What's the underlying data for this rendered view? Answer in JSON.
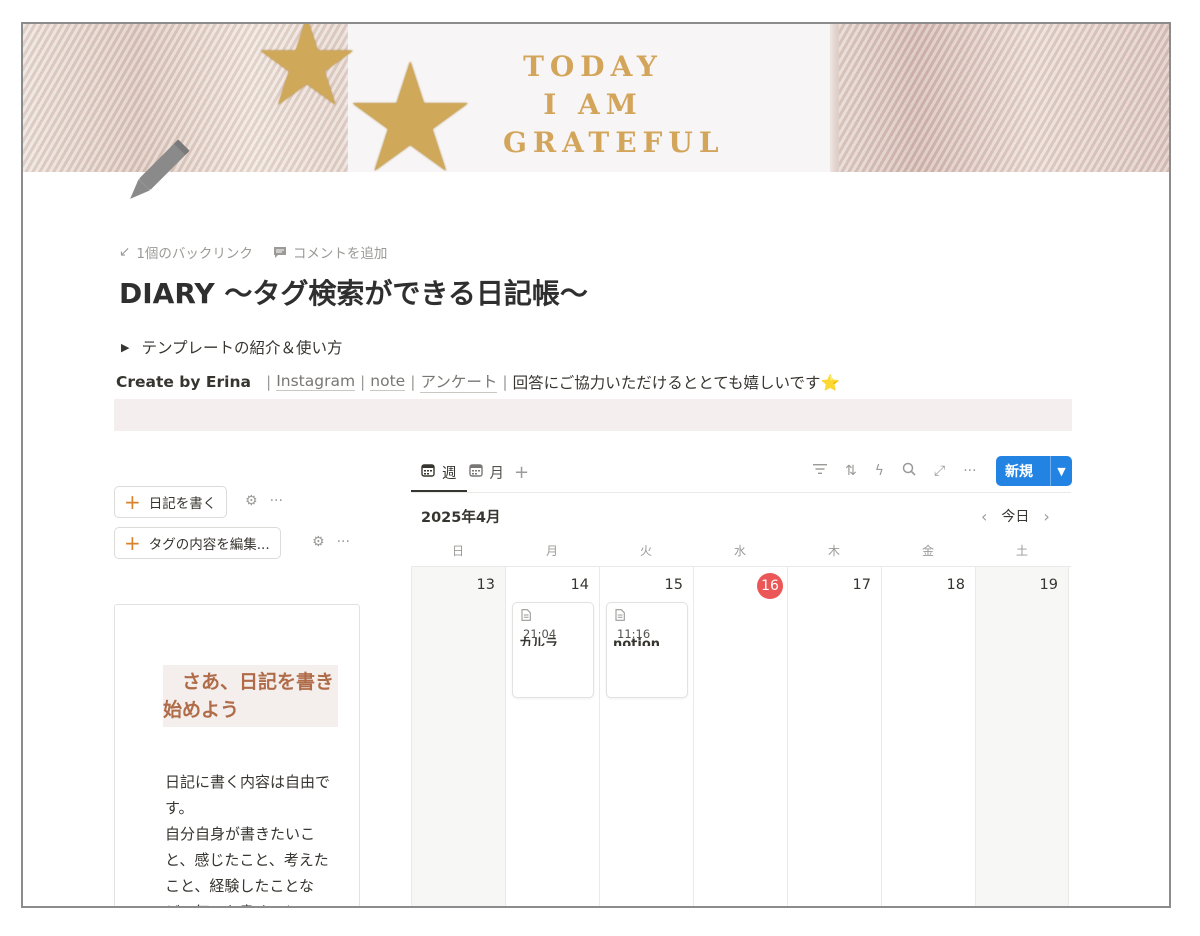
{
  "cover": {
    "text": "TODAY\nI AM\nGRATEFUL"
  },
  "meta": {
    "backlinks": "1個のバックリンク",
    "add_comment": "コメントを追加"
  },
  "title": "DIARY 〜タグ検索ができる日記帳〜",
  "toggle": "テンプレートの紹介＆使い方",
  "credits": {
    "prefix": "Create by Erina",
    "links": [
      "Instagram",
      "note",
      "アンケート"
    ],
    "message": "回答にご協力いただけるととても嬉しいです⭐"
  },
  "buttons": {
    "write_diary": "日記を書く",
    "edit_tags": "タグの内容を編集..."
  },
  "callout": {
    "heading": "　さあ、日記を書き始めよう",
    "body": "日記に書く内容は自由です。\n自分自身が書きたいこと、感じたこと、考えたこと、経験したことなど、何でも書くこと"
  },
  "calendar": {
    "tabs": [
      {
        "label": "週",
        "active": true
      },
      {
        "label": "月",
        "active": false
      }
    ],
    "new_button": "新規",
    "month_label": "2025年4月",
    "today_button": "今日",
    "weekdays": [
      "日",
      "月",
      "火",
      "水",
      "木",
      "金",
      "土"
    ],
    "dates": [
      "13",
      "14",
      "15",
      "16",
      "17",
      "18",
      "19"
    ],
    "today_date": "16",
    "events": [
      {
        "day": "14",
        "time": "21:04",
        "title": "カルラ"
      },
      {
        "day": "15",
        "time": "11:16",
        "title": "notion"
      }
    ]
  },
  "colors": {
    "accent": "#2383e2",
    "today": "#eb5757",
    "plus": "#d9822b",
    "callout_heading": "#b06c48"
  }
}
